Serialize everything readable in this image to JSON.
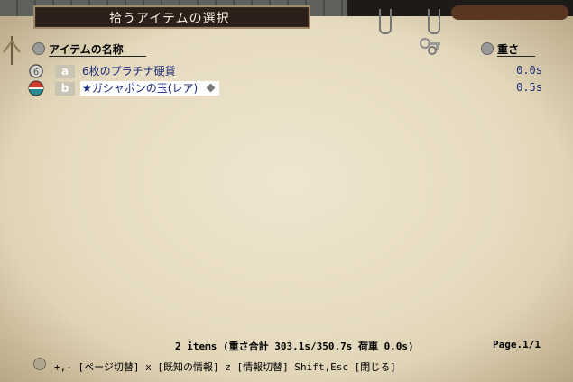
{
  "window": {
    "title": "拾うアイテムの選択"
  },
  "columns": {
    "name": "アイテムの名称",
    "weight": "重さ"
  },
  "items": [
    {
      "key": "a",
      "name": "6枚のプラチナ硬貨",
      "weight": "0.0s",
      "icon": "coin-icon"
    },
    {
      "key": "b",
      "name": "★ガシャポンの玉(レア)",
      "weight": "0.5s",
      "icon": "gacha-ball-icon",
      "selected": true
    }
  ],
  "footer": {
    "summary": "2 items  (重さ合計 303.1s/350.7s  荷車 0.0s)",
    "page": "Page.1/1",
    "help": "+,- [ページ切替]  x [既知の情報]  z [情報切替]  Shift,Esc [閉じる]"
  },
  "colors": {
    "title_bg": "#2b1f1a",
    "item_text": "#1c2a78",
    "parchment": "#e6dbc0"
  }
}
